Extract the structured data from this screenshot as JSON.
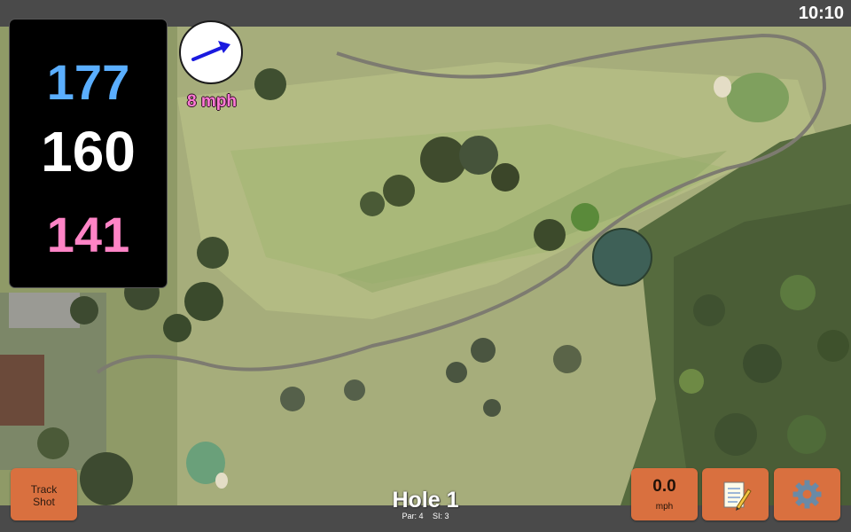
{
  "status": {
    "clock": "10:10"
  },
  "yardages": {
    "back": "177",
    "middle": "160",
    "front": "141"
  },
  "wind": {
    "speed": "8 mph",
    "arrow_icon": "arrow-right-icon",
    "arrow_color": "#1a1adf"
  },
  "buttons": {
    "track_shot_line1": "Track",
    "track_shot_line2": "Shot",
    "speed_value": "0.0",
    "speed_unit": "mph",
    "notes_icon": "notepad-icon",
    "settings_icon": "gear-icon"
  },
  "hole": {
    "title": "Hole 1",
    "par": "Par: 4",
    "si": "SI: 3"
  },
  "colors": {
    "button": "#d9703f",
    "back_yardage": "#5aaeff",
    "front_yardage": "#ff84c6",
    "wind_label": "#ff7ad6"
  }
}
